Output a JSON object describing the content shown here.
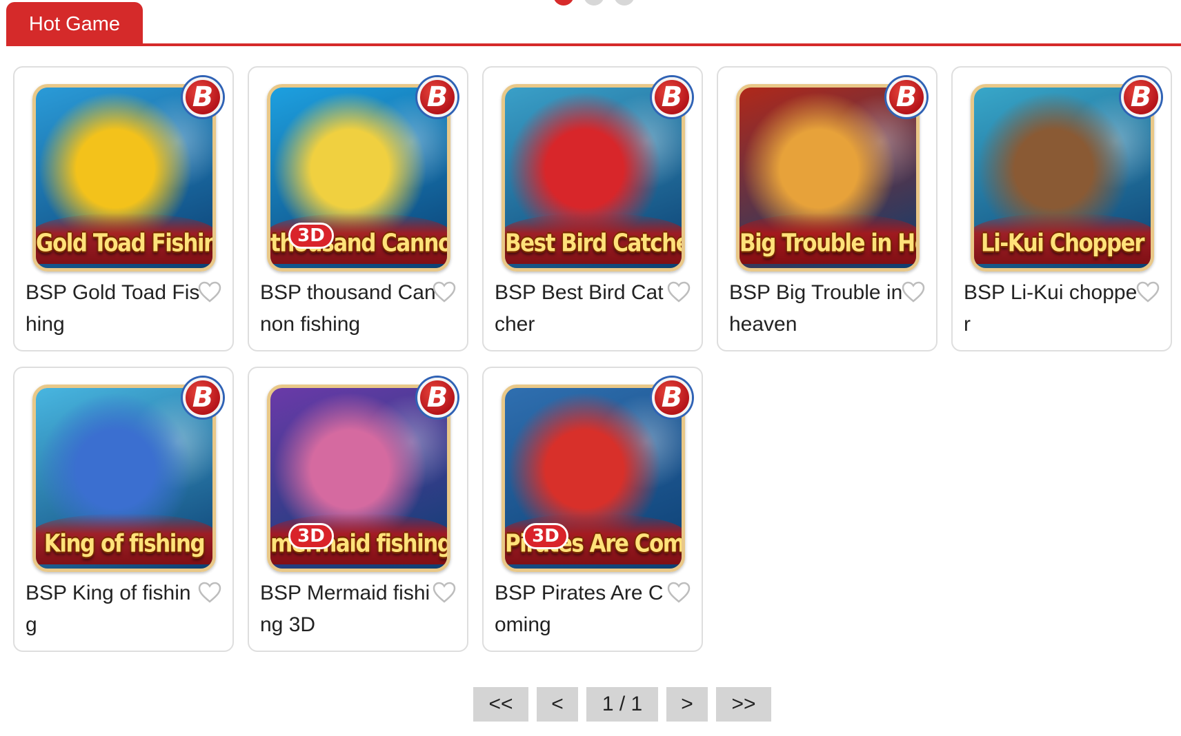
{
  "section": {
    "tab_label": "Hot Game"
  },
  "carousel": {
    "dots": [
      true,
      false,
      false
    ]
  },
  "games": [
    {
      "name": "BSP Gold Toad Fishing",
      "art_title": "Gold Toad Fishing",
      "badge_3d": "",
      "badge_b": "B",
      "theme": [
        "#2a9bd8",
        "#f3c21b"
      ]
    },
    {
      "name": "BSP thousand Cannon fishing",
      "art_title": "thousand Cannon Fishing",
      "badge_3d": "3D",
      "badge_b": "B",
      "theme": [
        "#1da0e0",
        "#f0d040"
      ]
    },
    {
      "name": "BSP Best Bird Catcher",
      "art_title": "Best Bird Catcher",
      "badge_3d": "",
      "badge_b": "B",
      "theme": [
        "#3aa0c8",
        "#d8262a"
      ]
    },
    {
      "name": "BSP Big Trouble in heaven",
      "art_title": "Big Trouble in Heaven",
      "badge_3d": "",
      "badge_b": "B",
      "theme": [
        "#b0281a",
        "#e7a23a"
      ]
    },
    {
      "name": "BSP Li-Kui chopper",
      "art_title": "Li-Kui Chopper",
      "badge_3d": "",
      "badge_b": "B",
      "theme": [
        "#38a7c9",
        "#8a5a34"
      ]
    },
    {
      "name": "BSP King of fishing",
      "art_title": "King of fishing",
      "badge_3d": "",
      "badge_b": "B",
      "theme": [
        "#48b6e0",
        "#3b6fd0"
      ]
    },
    {
      "name": "BSP Mermaid fishing 3D",
      "art_title": "mermaid fishing",
      "badge_3d": "3D",
      "badge_b": "B",
      "theme": [
        "#6a3aa8",
        "#d56aa0"
      ]
    },
    {
      "name": "BSP Pirates Are Coming",
      "art_title": "Pirates Are Coming",
      "badge_3d": "3D",
      "badge_b": "B",
      "theme": [
        "#2f6fb0",
        "#d8302a"
      ]
    }
  ],
  "pagination": {
    "first": "<<",
    "prev": "<",
    "current": "1 / 1",
    "next": ">",
    "last": ">>"
  }
}
